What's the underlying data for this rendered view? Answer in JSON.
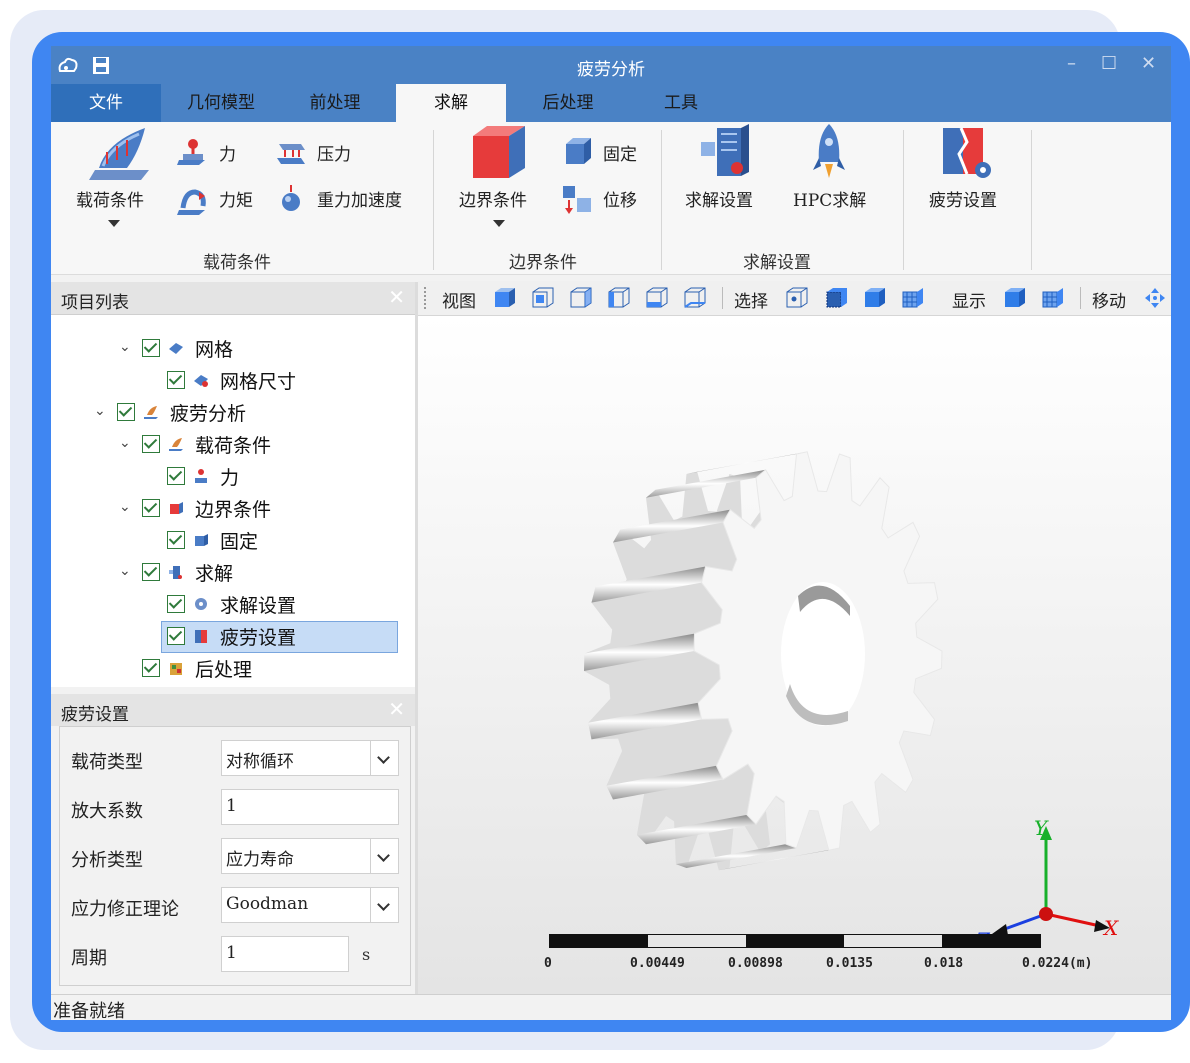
{
  "window": {
    "title": "疲劳分析"
  },
  "menu": {
    "tabs": [
      "文件",
      "几何模型",
      "前处理",
      "求解",
      "后处理",
      "工具"
    ],
    "active": "求解"
  },
  "ribbon": {
    "load": {
      "big_label": "载荷条件",
      "force": "力",
      "pressure": "压力",
      "moment": "力矩",
      "gravity": "重力加速度",
      "group": "载荷条件"
    },
    "boundary": {
      "big_label": "边界条件",
      "fixed": "固定",
      "displacement": "位移",
      "group": "边界条件"
    },
    "solve": {
      "settings": "求解设置",
      "hpc": "HPC求解",
      "group": "求解设置"
    },
    "fatigue": {
      "settings": "疲劳设置"
    }
  },
  "project_panel": {
    "title": "项目列表",
    "tree": [
      {
        "label": "网格"
      },
      {
        "label": "网格尺寸"
      },
      {
        "label": "疲劳分析"
      },
      {
        "label": "载荷条件"
      },
      {
        "label": "力"
      },
      {
        "label": "边界条件"
      },
      {
        "label": "固定"
      },
      {
        "label": "求解"
      },
      {
        "label": "求解设置"
      },
      {
        "label": "疲劳设置"
      },
      {
        "label": "后处理"
      }
    ]
  },
  "props_panel": {
    "title": "疲劳设置",
    "rows": [
      {
        "label": "载荷类型",
        "value": "对称循环"
      },
      {
        "label": "放大系数",
        "value": "1"
      },
      {
        "label": "分析类型",
        "value": "应力寿命"
      },
      {
        "label": "应力修正理论",
        "value": "Goodman"
      },
      {
        "label": "周期",
        "value": "1",
        "unit": "s"
      }
    ]
  },
  "view_toolbar": {
    "view": "视图",
    "select": "选择",
    "display": "显示",
    "move": "移动"
  },
  "viewport": {
    "axes": {
      "x": "X",
      "y": "Y",
      "z": "Z"
    },
    "scale_labels": [
      "0",
      "0.00449",
      "0.00898",
      "0.0135",
      "0.018",
      "0.0224(m)"
    ]
  },
  "status": {
    "text": "准备就绪"
  },
  "colors": {
    "titlebar": "#4a82c5",
    "file_tab": "#2f6fba",
    "frame": "#3f86f2",
    "selection": "#c6dcf6"
  }
}
